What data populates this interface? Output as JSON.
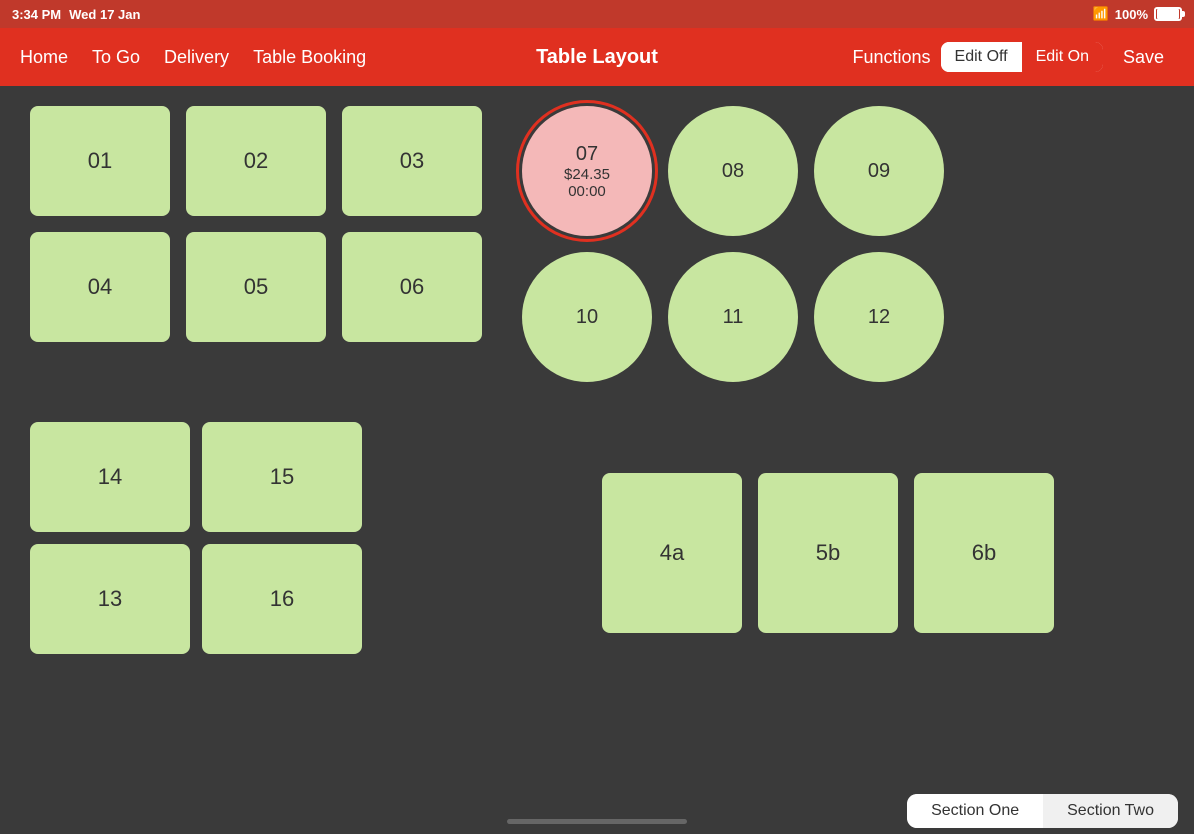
{
  "statusBar": {
    "time": "3:34 PM",
    "date": "Wed 17 Jan",
    "battery": "100%"
  },
  "navBar": {
    "links": [
      "Home",
      "To Go",
      "Delivery",
      "Table Booking"
    ],
    "title": "Table Layout",
    "functions": "Functions",
    "editOff": "Edit Off",
    "editOn": "Edit On",
    "save": "Save"
  },
  "tables": {
    "squareRow1": [
      "01",
      "02",
      "03"
    ],
    "squareRow2": [
      "04",
      "05",
      "06"
    ],
    "circleRow1": [
      {
        "id": "07",
        "amount": "$24.35",
        "time": "00:00",
        "occupied": true,
        "selected": true
      },
      {
        "id": "08",
        "occupied": false
      },
      {
        "id": "09",
        "occupied": false
      }
    ],
    "circleRow2": [
      {
        "id": "10",
        "occupied": false
      },
      {
        "id": "11",
        "occupied": false
      },
      {
        "id": "12",
        "occupied": false
      }
    ],
    "bottomLeft": [
      "14",
      "15",
      "13",
      "16"
    ],
    "bottomRight": [
      "4a",
      "5b",
      "6b"
    ]
  },
  "bottomBar": {
    "sectionOne": "Section One",
    "sectionTwo": "Section Two"
  }
}
